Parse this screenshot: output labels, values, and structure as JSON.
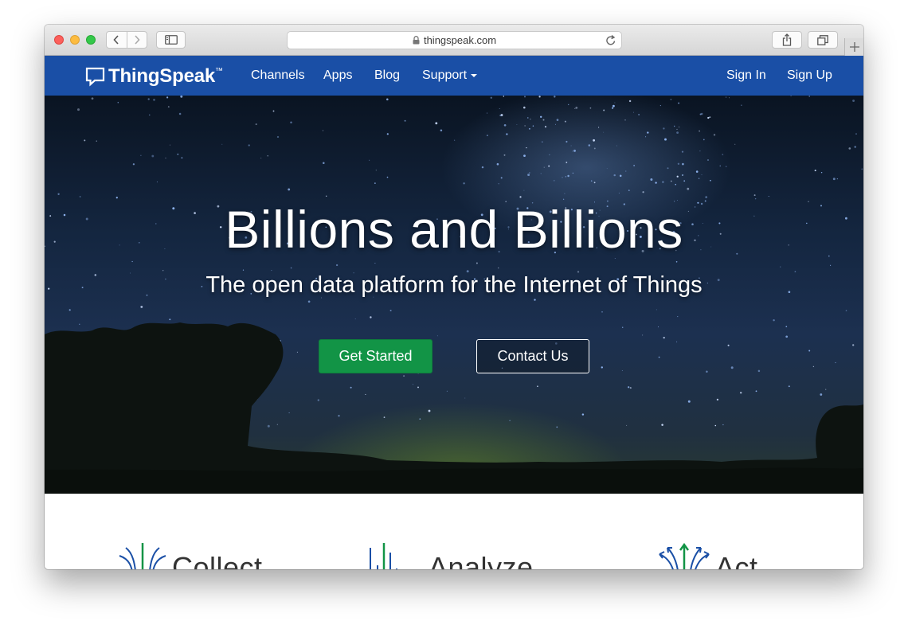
{
  "browser": {
    "url": "thingspeak.com",
    "icons": {
      "back": "chevron-left-icon",
      "forward": "chevron-right-icon",
      "sidebar": "sidebar-icon",
      "lock": "lock-icon",
      "reload": "reload-icon",
      "share": "share-icon",
      "tabs": "tabs-overview-icon",
      "new_tab": "plus-icon"
    }
  },
  "nav": {
    "brand": "ThingSpeak",
    "brand_tm": "™",
    "links": [
      "Channels",
      "Apps",
      "Blog"
    ],
    "support": "Support",
    "sign_in": "Sign In",
    "sign_up": "Sign Up",
    "background_color": "#1a4fa6"
  },
  "hero": {
    "title": "Billions and Billions",
    "subtitle": "The open data platform for the Internet of Things",
    "primary_button": "Get Started",
    "secondary_button": "Contact Us",
    "primary_color": "#129446"
  },
  "features": [
    {
      "label": "Collect",
      "icon": "collect-icon"
    },
    {
      "label": "Analyze",
      "icon": "analyze-icon"
    },
    {
      "label": "Act",
      "icon": "act-icon"
    }
  ]
}
